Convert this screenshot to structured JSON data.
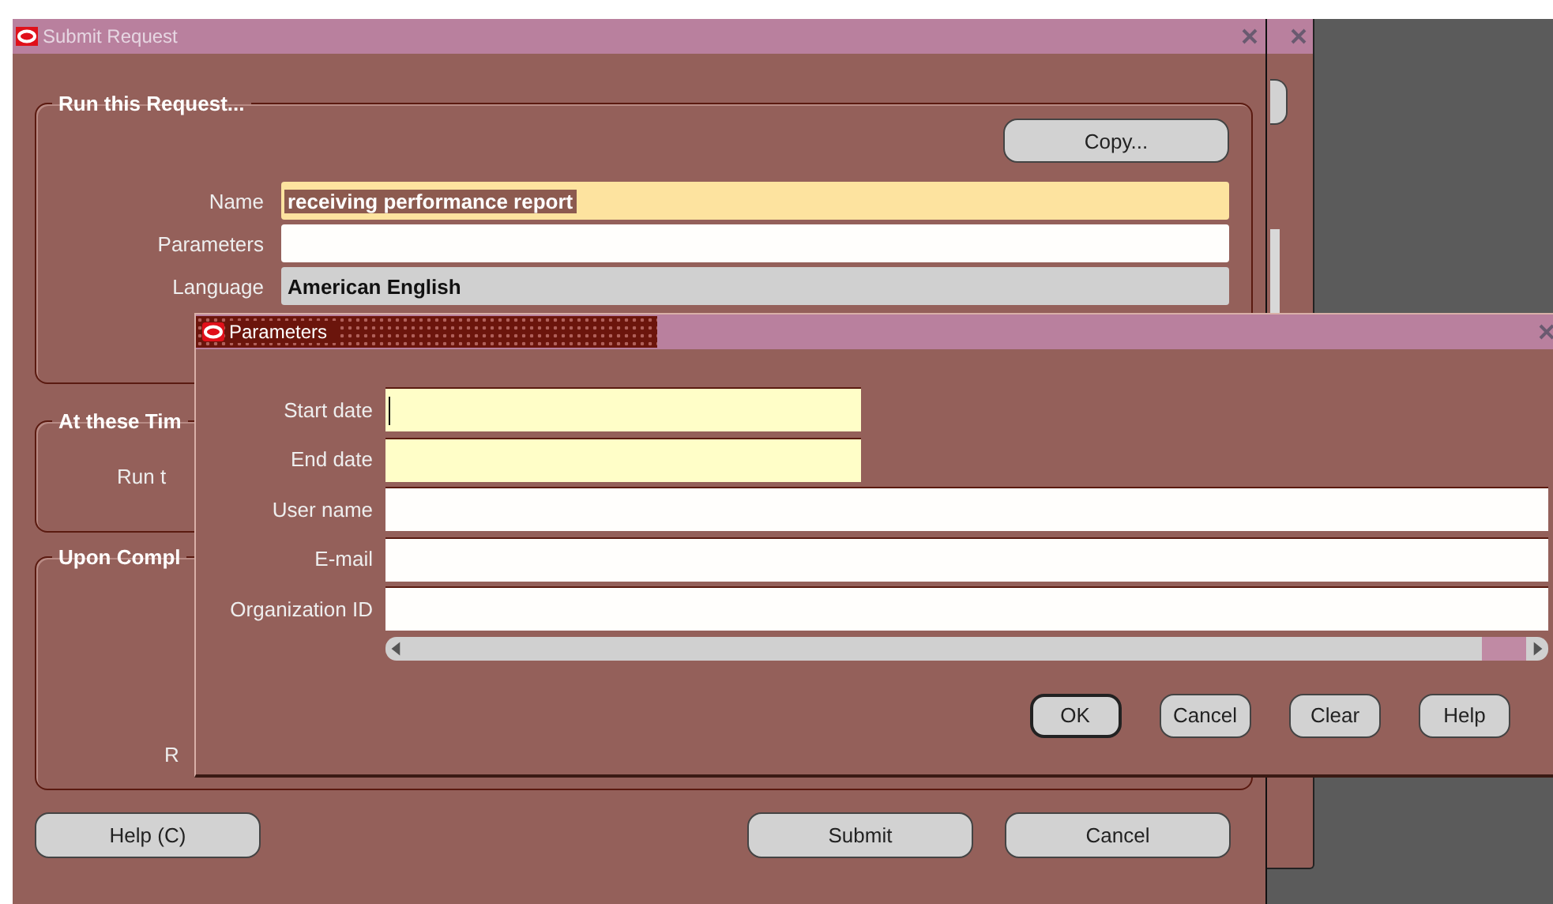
{
  "main_window": {
    "title": "Submit Request",
    "groups": [
      {
        "title": "Run this Request...",
        "button": "Copy...",
        "fields": [
          {
            "label": "Name",
            "value": "receiving performance report",
            "kind": "required",
            "selected": true
          },
          {
            "label": "Parameters",
            "kind": "plain"
          },
          {
            "label": "Language",
            "value": "American English",
            "kind": "readonly"
          }
        ]
      },
      {
        "title": "At these Tim",
        "labels": [
          "Run t"
        ]
      },
      {
        "title": "Upon Compl",
        "labels": [
          "R"
        ]
      }
    ],
    "left_buttons": [
      "Help (C)"
    ],
    "right_buttons": [
      "Submit",
      "Cancel"
    ]
  },
  "dialog": {
    "title": "Parameters",
    "active": true,
    "fields": [
      {
        "label": "Start date",
        "kind": "date",
        "focused": true
      },
      {
        "label": "End date",
        "kind": "date",
        "focused": false
      },
      {
        "label": "User name",
        "kind": "text",
        "focused": false
      },
      {
        "label": "E-mail",
        "kind": "text",
        "focused": false
      },
      {
        "label": "Organization ID",
        "kind": "text",
        "focused": false
      }
    ],
    "buttons": [
      {
        "label": "OK",
        "default": true
      },
      {
        "label": "Cancel",
        "default": false
      },
      {
        "label": "Clear",
        "default": false
      },
      {
        "label": "Help",
        "default": false
      }
    ]
  }
}
